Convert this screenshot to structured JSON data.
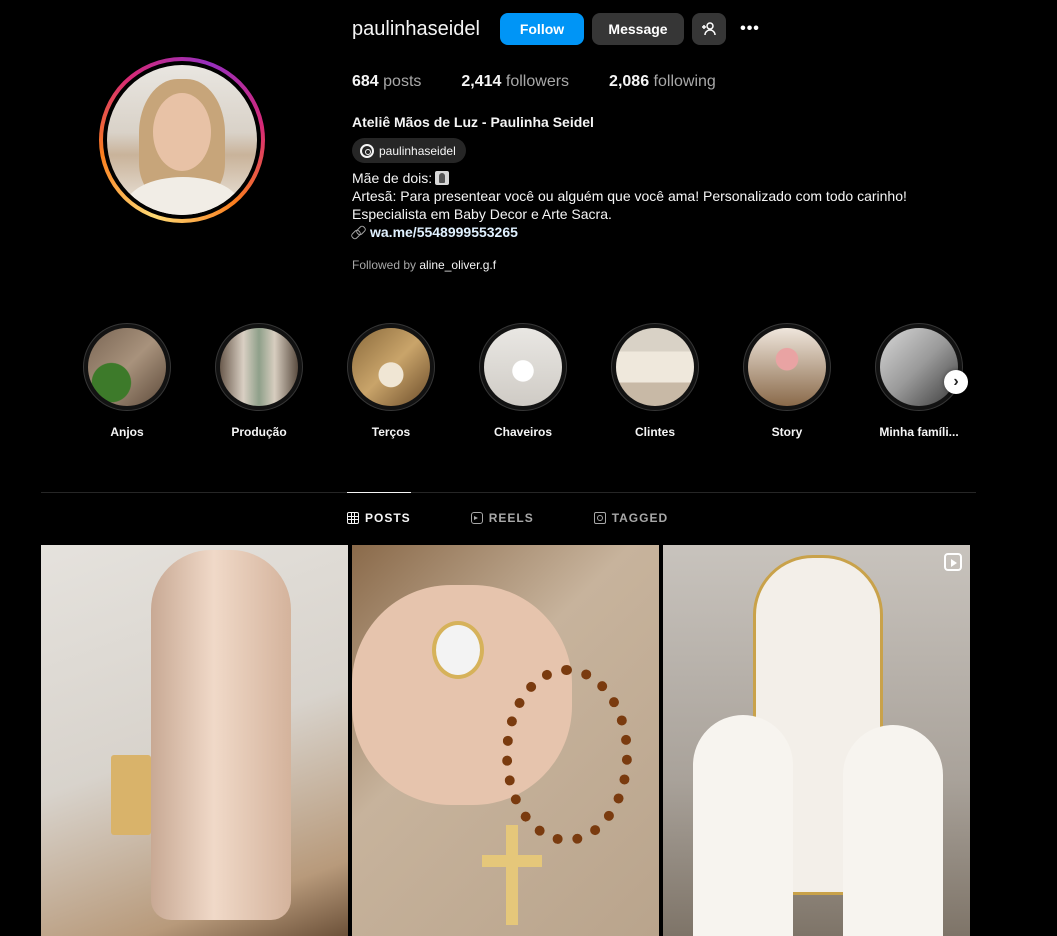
{
  "profile": {
    "username": "paulinhaseidel",
    "full_name": "Ateliê Mãos de Luz - Paulinha Seidel",
    "threads_handle": "paulinhaseidel",
    "bio_lines": [
      "Mãe de dois:",
      "Artesã: Para presentear você ou alguém que você ama! Personalizado com todo carinho!",
      "Especialista em Baby Decor e Arte Sacra."
    ],
    "link": "wa.me/5548999553265",
    "followed_by_prefix": "Followed by",
    "followed_by_user": "aline_oliver.g.f"
  },
  "actions": {
    "follow_label": "Follow",
    "message_label": "Message",
    "more_label": "•••"
  },
  "stats": {
    "posts_count": "684",
    "posts_label": "posts",
    "followers_count": "2,414",
    "followers_label": "followers",
    "following_count": "2,086",
    "following_label": "following"
  },
  "highlights": [
    {
      "label": "Anjos"
    },
    {
      "label": "Produção"
    },
    {
      "label": "Terços"
    },
    {
      "label": "Chaveiros"
    },
    {
      "label": "Clintes"
    },
    {
      "label": "Story"
    },
    {
      "label": "Minha famíli..."
    }
  ],
  "tabs": [
    {
      "label": "POSTS",
      "active": true
    },
    {
      "label": "REELS",
      "active": false
    },
    {
      "label": "TAGGED",
      "active": false
    }
  ],
  "colors": {
    "accent": "#0095f6",
    "background": "#000000",
    "button_secondary": "#363636"
  }
}
